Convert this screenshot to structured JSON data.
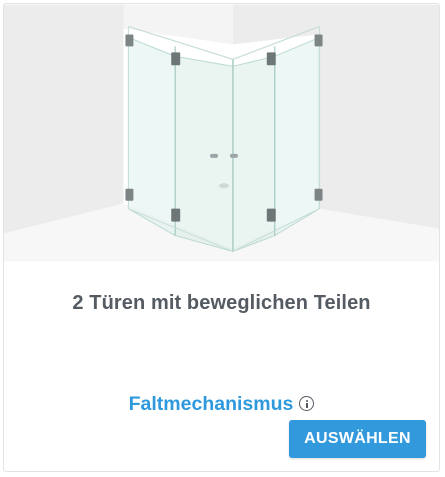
{
  "card": {
    "title": "2 Türen mit beweglichen Teilen",
    "mechanism_label": "Faltmechanismus",
    "info_icon": "info-icon",
    "select_label": "AUSWÄHLEN",
    "image_icon": "corner-shower-folding-doors-illustration"
  },
  "colors": {
    "accent": "#3399dd",
    "title_text": "#555b62",
    "link_text": "#2e99dc",
    "background_wall": "#eeeeee",
    "glass": "#dff0ec"
  }
}
